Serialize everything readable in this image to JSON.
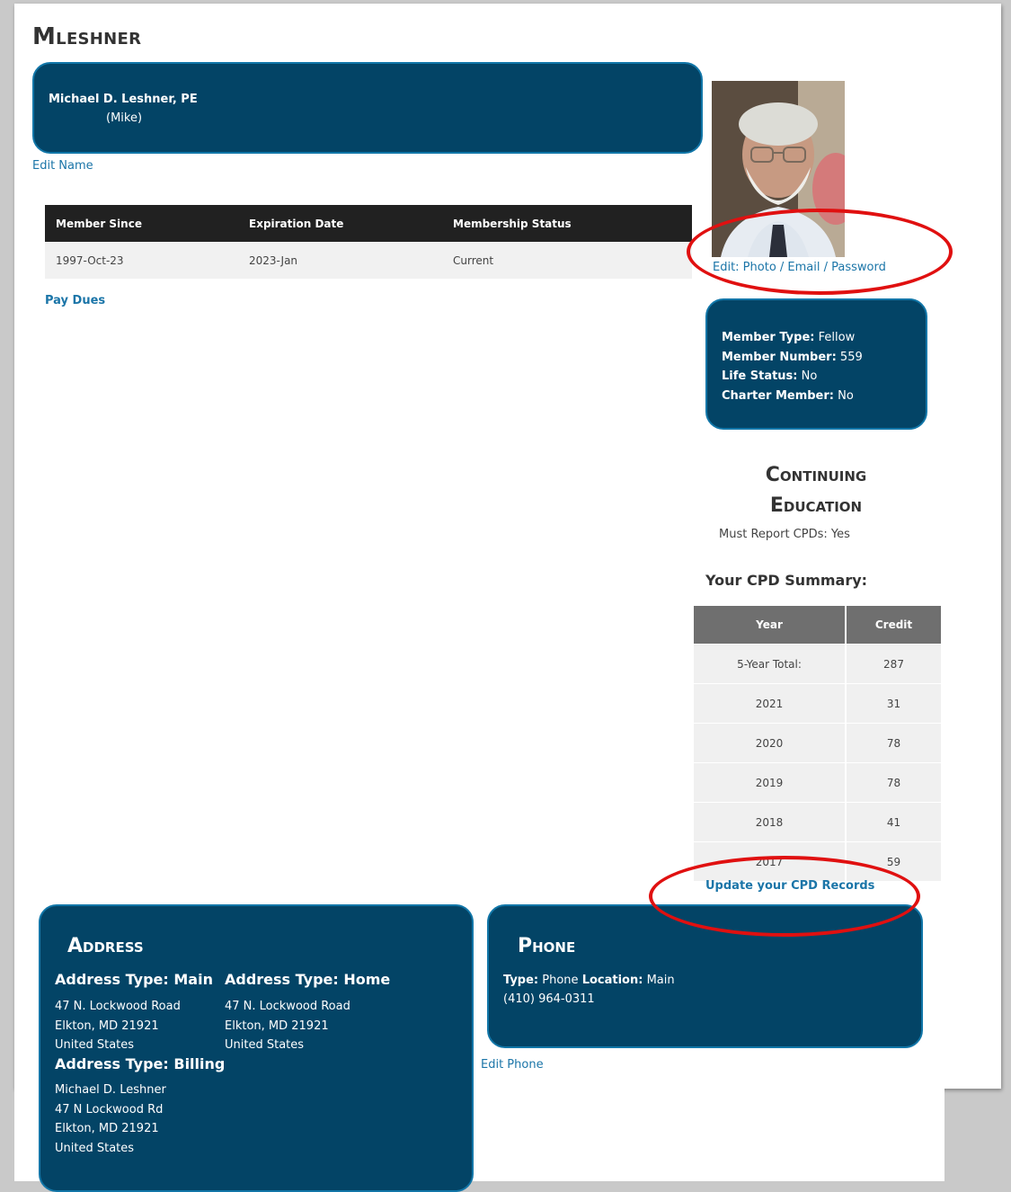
{
  "page_title": "Mleshner",
  "name_card": {
    "full_name": "Michael D. Leshner, PE",
    "nickname": "(Mike)"
  },
  "edit_name_label": "Edit Name",
  "membership_table": {
    "headers": [
      "Member Since",
      "Expiration Date",
      "Membership Status"
    ],
    "row": [
      "1997-Oct-23",
      "2023-Jan",
      "Current"
    ]
  },
  "pay_dues_label": "Pay Dues",
  "photo_edit_label": "Edit: Photo / Email / Password",
  "member_info": [
    {
      "label": "Member Type:",
      "value": "Fellow"
    },
    {
      "label": "Member Number:",
      "value": "559"
    },
    {
      "label": "Life Status:",
      "value": "No"
    },
    {
      "label": "Charter Member:",
      "value": "No"
    }
  ],
  "continuing_education": {
    "title_line1": "Continuing",
    "title_line2": "Education",
    "must_report": "Must Report CPDs: Yes",
    "summary_heading": "Your CPD Summary:",
    "table_headers": [
      "Year",
      "Credit"
    ],
    "rows": [
      [
        "5-Year Total:",
        "287"
      ],
      [
        "2021",
        "31"
      ],
      [
        "2020",
        "78"
      ],
      [
        "2019",
        "78"
      ],
      [
        "2018",
        "41"
      ],
      [
        "2017",
        "59"
      ]
    ],
    "update_label": "Update your CPD Records"
  },
  "address": {
    "heading": "Address",
    "main": {
      "type": "Address Type: Main",
      "lines": [
        "47 N. Lockwood Road",
        "Elkton, MD 21921",
        "United States"
      ]
    },
    "home": {
      "type": "Address Type: Home",
      "lines": [
        "47 N. Lockwood Road",
        "Elkton, MD 21921",
        "United States"
      ]
    },
    "billing": {
      "type": "Address Type: Billing",
      "lines": [
        "Michael D. Leshner",
        "47 N Lockwood Rd",
        "Elkton, MD 21921",
        "United States"
      ]
    }
  },
  "phone": {
    "heading": "Phone",
    "type_label": "Type:",
    "type_value": "Phone",
    "location_label": "Location:",
    "location_value": "Main",
    "number": "(410) 964-0311"
  },
  "edit_phone_label": "Edit Phone",
  "colors": {
    "card_navy": "#034466",
    "card_border": "#1176a8",
    "link_blue": "#1b75a8",
    "annotation_red": "#e01010"
  }
}
